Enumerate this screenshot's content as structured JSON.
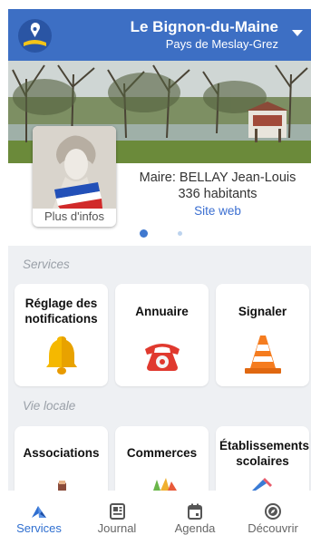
{
  "header": {
    "title": "Le Bignon-du-Maine",
    "subtitle": "Pays de Meslay-Grez",
    "brand_color": "#3d6fc4"
  },
  "town": {
    "mayor": "Maire: BELLAY Jean-Louis",
    "population": "336 habitants",
    "website": "Site web",
    "more_info": "Plus d'infos"
  },
  "carousel": {
    "page_count": 2,
    "active_page": 1
  },
  "sections": {
    "services": {
      "title": "Services",
      "cards": [
        {
          "label": "Réglage des notifications",
          "icon": "bell-icon"
        },
        {
          "label": "Annuaire",
          "icon": "telephone-icon"
        },
        {
          "label": "Signaler",
          "icon": "traffic-cone-icon"
        }
      ]
    },
    "vie_locale": {
      "title": "Vie locale",
      "cards": [
        {
          "label": "Associations",
          "icon": "associations-icon"
        },
        {
          "label": "Commerces",
          "icon": "shopping-icon"
        },
        {
          "label": "Établissements scolaires",
          "icon": "school-supplies-icon"
        }
      ]
    }
  },
  "tabs": [
    {
      "label": "Services",
      "icon": "services-icon",
      "active": true
    },
    {
      "label": "Journal",
      "icon": "newspaper-icon",
      "active": false
    },
    {
      "label": "Agenda",
      "icon": "calendar-icon",
      "active": false
    },
    {
      "label": "Découvrir",
      "icon": "compass-icon",
      "active": false
    }
  ]
}
